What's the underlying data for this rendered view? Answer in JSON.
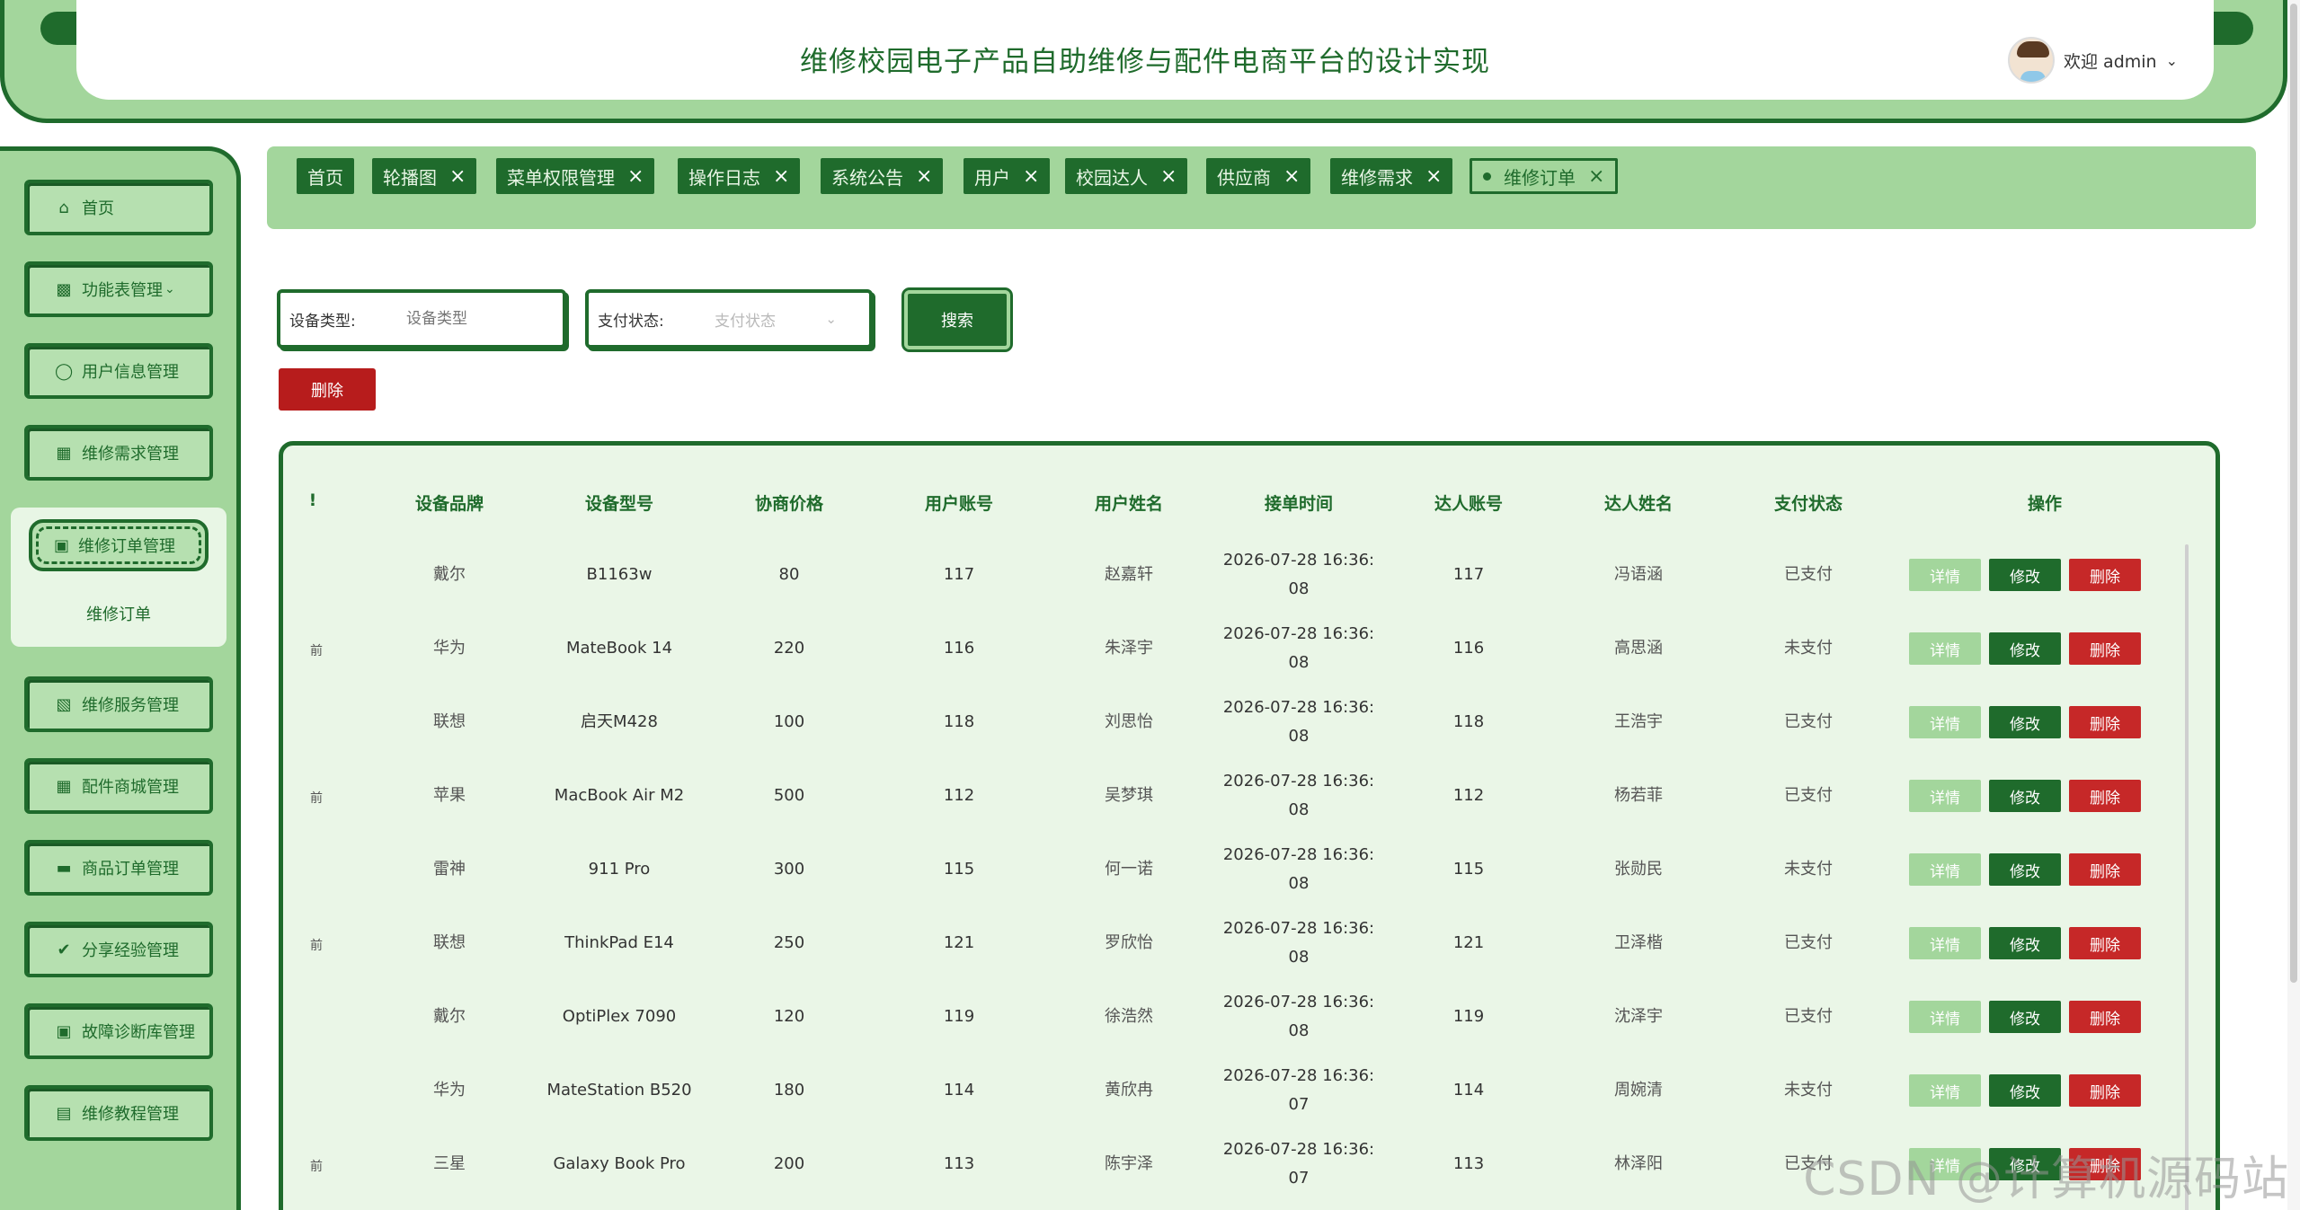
{
  "header": {
    "title": "维修校园电子产品自助维修与配件电商平台的设计实现",
    "welcome": "欢迎 admin",
    "dropdown_icon": "chevron-down-icon"
  },
  "sidebar": {
    "items": [
      {
        "label": "首页",
        "icon": "home-icon"
      },
      {
        "label": "功能表管理",
        "icon": "chart-icon"
      },
      {
        "label": "用户信息管理",
        "icon": "user-icon"
      },
      {
        "label": "维修需求管理",
        "icon": "grid-icon"
      },
      {
        "label": "维修订单管理",
        "icon": "order-icon"
      },
      {
        "label": "维修服务管理",
        "icon": "folder-icon"
      },
      {
        "label": "配件商城管理",
        "icon": "grid-icon"
      },
      {
        "label": "商品订单管理",
        "icon": "list-icon"
      },
      {
        "label": "分享经验管理",
        "icon": "check-circle-icon"
      },
      {
        "label": "故障诊断库管理",
        "icon": "order-icon"
      },
      {
        "label": "维修教程管理",
        "icon": "book-icon"
      }
    ],
    "submenu": "维修订单"
  },
  "tabs": [
    {
      "label": "首页"
    },
    {
      "label": "轮播图"
    },
    {
      "label": "菜单权限管理"
    },
    {
      "label": "操作日志"
    },
    {
      "label": "系统公告"
    },
    {
      "label": "用户"
    },
    {
      "label": "校园达人"
    },
    {
      "label": "供应商"
    },
    {
      "label": "维修需求"
    },
    {
      "label": "维修订单"
    }
  ],
  "search": {
    "device_type_label": "设备类型:",
    "device_type_placeholder": "设备类型",
    "pay_status_label": "支付状态:",
    "pay_status_placeholder": "支付状态",
    "search_button": "搜索",
    "delete_button": "删除"
  },
  "table": {
    "columns": [
      "!",
      "设备品牌",
      "设备型号",
      "协商价格",
      "用户账号",
      "用户姓名",
      "接单时间",
      "达人账号",
      "达人姓名",
      "支付状态",
      "操作"
    ],
    "actions": {
      "detail": "详情",
      "edit": "修改",
      "delete": "删除"
    },
    "rows": [
      {
        "mark": "",
        "brand": "戴尔",
        "model": "B1163w",
        "price": "80",
        "user_account": "117",
        "user_name": "赵嘉轩",
        "time": "2026-07-28 16:36:08",
        "expert_account": "117",
        "expert_name": "冯语涵",
        "pay_status": "已支付"
      },
      {
        "mark": "前",
        "brand": "华为",
        "model": "MateBook 14",
        "price": "220",
        "user_account": "116",
        "user_name": "朱泽宇",
        "time": "2026-07-28 16:36:08",
        "expert_account": "116",
        "expert_name": "高思涵",
        "pay_status": "未支付"
      },
      {
        "mark": "",
        "brand": "联想",
        "model": "启天M428",
        "price": "100",
        "user_account": "118",
        "user_name": "刘思怡",
        "time": "2026-07-28 16:36:08",
        "expert_account": "118",
        "expert_name": "王浩宇",
        "pay_status": "已支付"
      },
      {
        "mark": "前",
        "brand": "苹果",
        "model": "MacBook Air M2",
        "price": "500",
        "user_account": "112",
        "user_name": "吴梦琪",
        "time": "2026-07-28 16:36:08",
        "expert_account": "112",
        "expert_name": "杨若菲",
        "pay_status": "已支付"
      },
      {
        "mark": "",
        "brand": "雷神",
        "model": "911 Pro",
        "price": "300",
        "user_account": "115",
        "user_name": "何一诺",
        "time": "2026-07-28 16:36:08",
        "expert_account": "115",
        "expert_name": "张勋民",
        "pay_status": "未支付"
      },
      {
        "mark": "前",
        "brand": "联想",
        "model": "ThinkPad E14",
        "price": "250",
        "user_account": "121",
        "user_name": "罗欣怡",
        "time": "2026-07-28 16:36:08",
        "expert_account": "121",
        "expert_name": "卫泽楷",
        "pay_status": "已支付"
      },
      {
        "mark": "",
        "brand": "戴尔",
        "model": "OptiPlex 7090",
        "price": "120",
        "user_account": "119",
        "user_name": "徐浩然",
        "time": "2026-07-28 16:36:08",
        "expert_account": "119",
        "expert_name": "沈泽宇",
        "pay_status": "已支付"
      },
      {
        "mark": "",
        "brand": "华为",
        "model": "MateStation B520",
        "price": "180",
        "user_account": "114",
        "user_name": "黄欣冉",
        "time": "2026-07-28 16:36:07",
        "expert_account": "114",
        "expert_name": "周婉清",
        "pay_status": "未支付"
      },
      {
        "mark": "前",
        "brand": "三星",
        "model": "Galaxy Book Pro",
        "price": "200",
        "user_account": "113",
        "user_name": "陈宇泽",
        "time": "2026-07-28 16:36:07",
        "expert_account": "113",
        "expert_name": "林泽阳",
        "pay_status": "已支付"
      }
    ]
  },
  "watermark": "CSDN @计算机源码站"
}
